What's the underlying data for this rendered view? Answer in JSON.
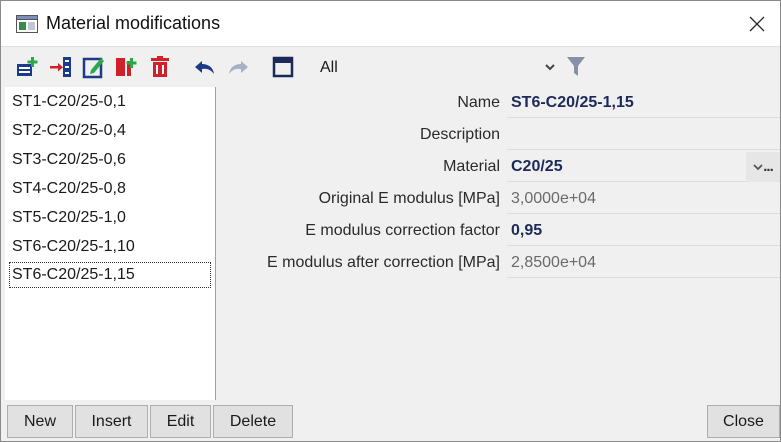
{
  "window": {
    "title": "Material modifications"
  },
  "toolbar": {
    "filter_value": "All",
    "icons": [
      "new-record-icon",
      "insert-icon",
      "edit-icon",
      "copy-icon",
      "delete-icon",
      "undo-icon",
      "redo-icon",
      "minimize-panel-icon",
      "filter-icon"
    ]
  },
  "list": {
    "items": [
      "ST1-C20/25-0,1",
      "ST2-C20/25-0,4",
      "ST3-C20/25-0,6",
      "ST4-C20/25-0,8",
      "ST5-C20/25-1,0",
      "ST6-C20/25-1,10",
      "ST6-C20/25-1,15"
    ],
    "selected_index": 6
  },
  "properties": {
    "name_label": "Name",
    "name_value": "ST6-C20/25-1,15",
    "description_label": "Description",
    "description_value": "",
    "material_label": "Material",
    "material_value": "C20/25",
    "material_button": "...",
    "orig_e_label": "Original E modulus [MPa]",
    "orig_e_value": "3,0000e+04",
    "corr_label": "E modulus correction factor",
    "corr_value": "0,95",
    "after_label": "E modulus after correction [MPa]",
    "after_value": "2,8500e+04"
  },
  "buttons": {
    "new": "New",
    "insert": "Insert",
    "edit": "Edit",
    "delete": "Delete",
    "close": "Close"
  },
  "colors": {
    "accent_blue": "#1c3a8a",
    "accent_green": "#2aa84a",
    "delete_red": "#d0202a"
  }
}
